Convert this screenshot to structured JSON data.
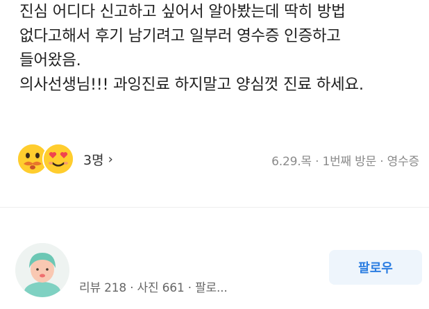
{
  "review": {
    "lines": [
      "진심 어디다 신고하고 싶어서 알아봤는데 딱히 방법",
      "없다고해서 후기 남기려고 일부러 영수증 인증하고",
      "들어왔음.",
      "의사선생님!!! 과잉진료 하지말고 양심껏 진료 하세요."
    ]
  },
  "reactions": {
    "count_label": "3명",
    "chevron": "›",
    "emojis": [
      "face-with-mustache-emoji",
      "heart-eyes-emoji"
    ]
  },
  "visit": {
    "meta": "6.29.목 · 1번째 방문 · 영수증"
  },
  "reviewer": {
    "stats": "리뷰 218 · 사진 661 · 팔로...",
    "follow_label": "팔로우"
  },
  "colors": {
    "accent": "#2b7de1",
    "follow_bg": "#eef5fc",
    "emoji_yellow": "#ffcd2e",
    "meta_gray": "#8a8a8a"
  }
}
